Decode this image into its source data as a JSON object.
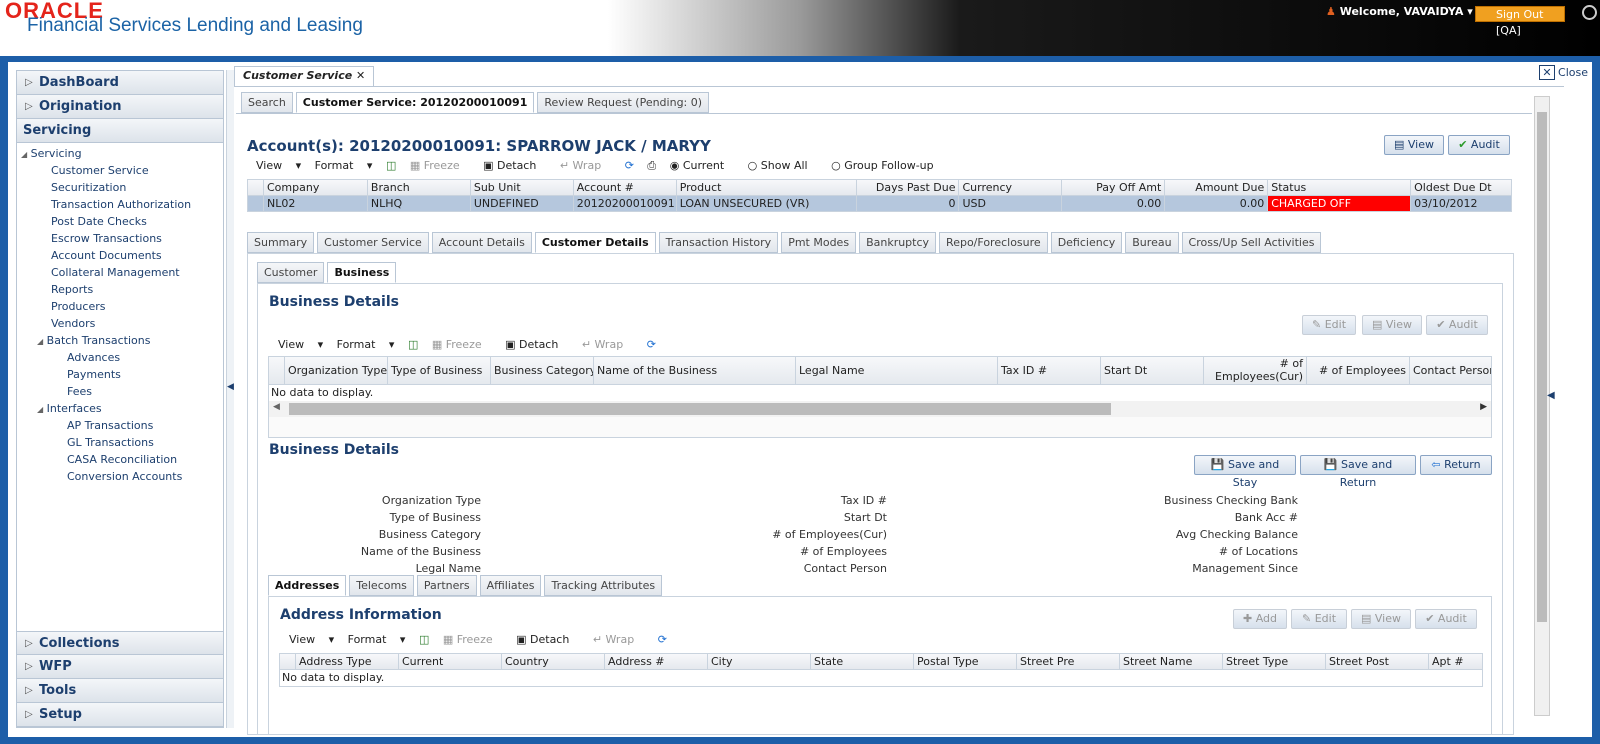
{
  "header": {
    "logo_line1": "ORACLE",
    "logo_line2": "Financial Services Lending and Leasing",
    "welcome": "Welcome, VAVAIDYA",
    "signout": "Sign Out [QA]"
  },
  "nav": {
    "top_sections": [
      "DashBoard",
      "Origination",
      "Servicing"
    ],
    "tree": [
      {
        "label": "Servicing",
        "level": 0
      },
      {
        "label": "Customer Service",
        "level": 1
      },
      {
        "label": "Securitization",
        "level": 1
      },
      {
        "label": "Transaction Authorization",
        "level": 1
      },
      {
        "label": "Post Date Checks",
        "level": 1
      },
      {
        "label": "Escrow Transactions",
        "level": 1
      },
      {
        "label": "Account Documents",
        "level": 1
      },
      {
        "label": "Collateral Management",
        "level": 1
      },
      {
        "label": "Reports",
        "level": 1
      },
      {
        "label": "Producers",
        "level": 1
      },
      {
        "label": "Vendors",
        "level": 1
      },
      {
        "label": "Batch Transactions",
        "level": 1,
        "folder": true
      },
      {
        "label": "Advances",
        "level": 2
      },
      {
        "label": "Payments",
        "level": 2
      },
      {
        "label": "Fees",
        "level": 2
      },
      {
        "label": "Interfaces",
        "level": 1,
        "folder": true
      },
      {
        "label": "AP Transactions",
        "level": 2
      },
      {
        "label": "GL Transactions",
        "level": 2
      },
      {
        "label": "CASA Reconciliation",
        "level": 2
      },
      {
        "label": "Conversion Accounts",
        "level": 2
      }
    ],
    "bottom_sections": [
      "Collections",
      "WFP",
      "Tools",
      "Setup"
    ]
  },
  "page_tab": "Customer Service",
  "close_label": "Close",
  "sub_tabs": [
    "Search",
    "Customer Service: 20120200010091",
    "Review Request (Pending: 0)"
  ],
  "account_title": "Account(s): 20120200010091: SPARROW JACK / MARYY",
  "toolbar": {
    "view": "View",
    "format": "Format",
    "freeze": "Freeze",
    "detach": "Detach",
    "wrap": "Wrap"
  },
  "radios": [
    "Current",
    "Show All",
    "Group Follow-up"
  ],
  "top_buttons": {
    "view": "View",
    "audit": "Audit"
  },
  "account_grid": {
    "headers": [
      "Company",
      "Branch",
      "Sub Unit",
      "Account #",
      "Product",
      "Days Past Due",
      "Currency",
      "Pay Off Amt",
      "Amount Due",
      "Status",
      "Oldest Due Dt"
    ],
    "row": [
      "NL02",
      "NLHQ",
      "UNDEFINED",
      "20120200010091",
      "LOAN UNSECURED (VR)",
      "0",
      "USD",
      "0.00",
      "0.00",
      "CHARGED OFF",
      "03/10/2012"
    ],
    "status_color": "#ff0000"
  },
  "detail_tabs": [
    "Summary",
    "Customer Service",
    "Account Details",
    "Customer Details",
    "Transaction History",
    "Pmt Modes",
    "Bankruptcy",
    "Repo/Foreclosure",
    "Deficiency",
    "Bureau",
    "Cross/Up Sell Activities"
  ],
  "inner_tabs": [
    "Customer",
    "Business"
  ],
  "business_section": {
    "title": "Business Details",
    "buttons": [
      "Edit",
      "View",
      "Audit"
    ],
    "headers": [
      "Organization Type",
      "Type of Business",
      "Business Category",
      "Name of the Business",
      "Legal Name",
      "Tax ID #",
      "Start Dt",
      "# of Employees(Cur)",
      "# of Employees",
      "Contact Person"
    ],
    "empty": "No data to display."
  },
  "business_form": {
    "title": "Business Details",
    "buttons": [
      "Save and Stay",
      "Save and Return",
      "Return"
    ],
    "col1": [
      "Organization Type",
      "Type of Business",
      "Business Category",
      "Name of the Business",
      "Legal Name"
    ],
    "col2": [
      "Tax ID #",
      "Start Dt",
      "# of Employees(Cur)",
      "# of Employees",
      "Contact Person"
    ],
    "col3": [
      "Business Checking Bank",
      "Bank Acc #",
      "Avg Checking Balance",
      "# of Locations",
      "Management Since"
    ]
  },
  "address_tabs": [
    "Addresses",
    "Telecoms",
    "Partners",
    "Affiliates",
    "Tracking Attributes"
  ],
  "address_section": {
    "title": "Address Information",
    "buttons": [
      "Add",
      "Edit",
      "View",
      "Audit"
    ],
    "headers": [
      "Address Type",
      "Current",
      "Country",
      "Address #",
      "City",
      "State",
      "Postal Type",
      "Street Pre",
      "Street Name",
      "Street Type",
      "Street Post",
      "Apt #"
    ],
    "empty": "No data to display."
  }
}
